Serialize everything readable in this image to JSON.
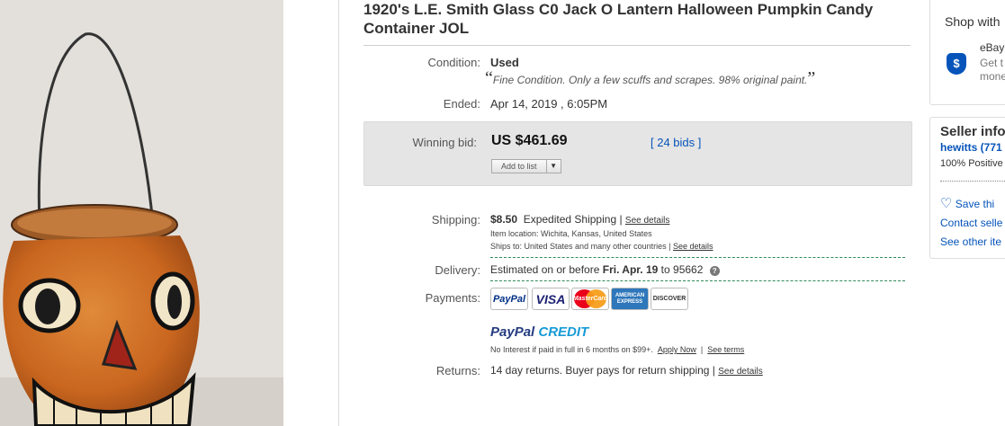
{
  "listing": {
    "title": "1920's L.E. Smith Glass C0 Jack O Lantern Halloween Pumpkin Candy Container JOL",
    "condition": {
      "label": "Condition:",
      "value": "Used",
      "note": "Fine Condition. Only a few scuffs and scrapes. 98% original paint."
    },
    "ended": {
      "label": "Ended:",
      "value": "Apr 14, 2019 , 6:05PM"
    },
    "winning": {
      "label": "Winning bid:",
      "price": "US $461.69",
      "bids": "[ 24 bids ]",
      "add_to_list": "Add to list"
    },
    "shipping": {
      "label": "Shipping:",
      "cost": "$8.50",
      "method": "Expedited Shipping |",
      "see_details": "See details",
      "location": "Item location:  Wichita, Kansas, United States",
      "ships_to": "Ships to:  United States and many other countries |",
      "ships_see_details": "See details"
    },
    "delivery": {
      "label": "Delivery:",
      "prefix": "Estimated on or before",
      "date": "Fri. Apr. 19",
      "suffix": "to 95662"
    },
    "payments": {
      "label": "Payments:",
      "methods": [
        {
          "name": "PayPal",
          "color": "#003087"
        },
        {
          "name": "VISA",
          "color": "#1a1f71"
        },
        {
          "name": "MasterCard",
          "color": "#eb001b"
        },
        {
          "name": "AMERICAN EXPRESS",
          "color": "#2e77bb"
        },
        {
          "name": "DISCOVER",
          "color": "#f58220"
        }
      ],
      "credit_part1": "PayPal",
      "credit_part2": "CREDIT",
      "credit_note": "No Interest if paid in full in 6 months on $99+.",
      "apply_now": "Apply Now",
      "see_terms": "See terms"
    },
    "returns": {
      "label": "Returns:",
      "value": "14 day returns. Buyer pays for return shipping |",
      "see_details": "See details"
    }
  },
  "sidebar": {
    "shop_title": "Shop with",
    "shop_line1": "eBay",
    "shop_line2": "Get t",
    "shop_line3": "mone",
    "seller_title": "Seller info",
    "seller_name": "hewitts (771",
    "seller_feedback": "100% Positive",
    "save_seller": "Save thi",
    "contact_seller": "Contact selle",
    "see_other": "See other ite"
  }
}
